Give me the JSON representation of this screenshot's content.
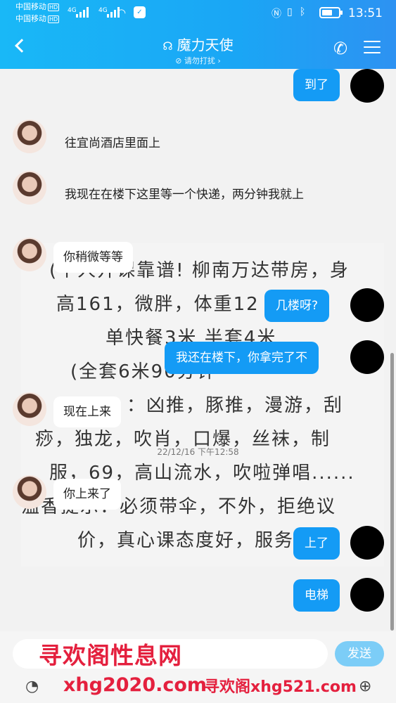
{
  "status": {
    "carrier1": "中国移动",
    "carrier2": "中国移动",
    "hd": "HD",
    "network": "4G",
    "time": "13:51"
  },
  "header": {
    "title": "魔力天使",
    "subtitle": "请勿打扰 ›"
  },
  "messages": {
    "m1": "到了",
    "m2": "往宜尚酒店里面上",
    "m3": "我现在在楼下这里等一个快递，两分钟我就上",
    "m4": "你稍微等等",
    "m5": "几楼呀?",
    "m6": "我还在楼下，你拿完了不",
    "m7": "现在上来",
    "m8": "你上来了",
    "m9": "上了",
    "m10": "电梯"
  },
  "timestamp": "22/12/16 下午12:58",
  "background_ad": {
    "l1": "(个人开课靠谱! 柳南万达带房，身",
    "l2": "高161，微胖，体重12",
    "l3": "单快餐3米   半套4米",
    "l4": "(全套6米90分钟",
    "l5": "：凶推，豚推，漫游，刮",
    "l6": "痧，独龙，吹肖，口爆，丝袜，制",
    "l7": "服，69，高山流水，吹啦弹唱......",
    "l8": "温香提示：必须带伞，不外，拒绝议",
    "l9": "价，真心课态度好，服务"
  },
  "input": {
    "send_label": "发送"
  },
  "watermarks": {
    "w1": "寻欢阁性息网",
    "w2": "xhg2020.com",
    "w3": "寻欢阁xhg521.com"
  }
}
